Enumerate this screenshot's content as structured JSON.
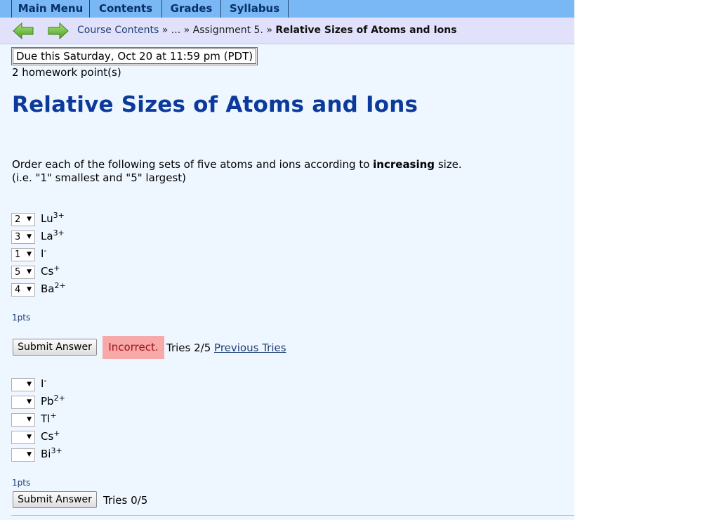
{
  "menu": {
    "main": "Main Menu",
    "contents": "Contents",
    "grades": "Grades",
    "syllabus": "Syllabus"
  },
  "breadcrumb": {
    "course_contents": "Course Contents",
    "sep1": "»",
    "ellipsis": "...",
    "sep2": "»",
    "assignment": "Assignment 5.",
    "sep3": "»",
    "current": "Relative Sizes of Atoms and Ions"
  },
  "due": "Due this Saturday, Oct 20 at 11:59 pm (PDT)",
  "homework_points": "2 homework point(s)",
  "title": "Relative Sizes of Atoms and Ions",
  "instructions": {
    "line1_pre": "Order each of the following sets of five atoms and ions according to ",
    "line1_bold": "increasing",
    "line1_post": " size.",
    "line2": "(i.e. \"1\" smallest and \"5\" largest)"
  },
  "problem1": {
    "items": [
      {
        "value": "2",
        "symbol": "Lu",
        "charge": "3+"
      },
      {
        "value": "3",
        "symbol": "La",
        "charge": "3+"
      },
      {
        "value": "1",
        "symbol": "I",
        "charge": "-"
      },
      {
        "value": "5",
        "symbol": "Cs",
        "charge": "+"
      },
      {
        "value": "4",
        "symbol": "Ba",
        "charge": "2+"
      }
    ],
    "points": "1pts",
    "submit_label": "Submit Answer",
    "status": "Incorrect.",
    "tries": "Tries 2/5",
    "previous_tries": "Previous Tries"
  },
  "problem2": {
    "items": [
      {
        "value": "",
        "symbol": "I",
        "charge": "-"
      },
      {
        "value": "",
        "symbol": "Pb",
        "charge": "2+"
      },
      {
        "value": "",
        "symbol": "Tl",
        "charge": "+"
      },
      {
        "value": "",
        "symbol": "Cs",
        "charge": "+"
      },
      {
        "value": "",
        "symbol": "Bi",
        "charge": "3+"
      }
    ],
    "points": "1pts",
    "submit_label": "Submit Answer",
    "tries": "Tries 0/5"
  },
  "icons": {
    "back": "back-arrow-icon",
    "forward": "forward-arrow-icon",
    "dropdown": "dropdown-arrow-icon"
  },
  "colors": {
    "menu_bar": "#7ab8f5",
    "menu_text": "#052f67",
    "title": "#0b3a9c",
    "incorrect_bg": "#f7a8a8",
    "incorrect_text": "#a0101a",
    "arrow_green": "#6dbb3c"
  }
}
